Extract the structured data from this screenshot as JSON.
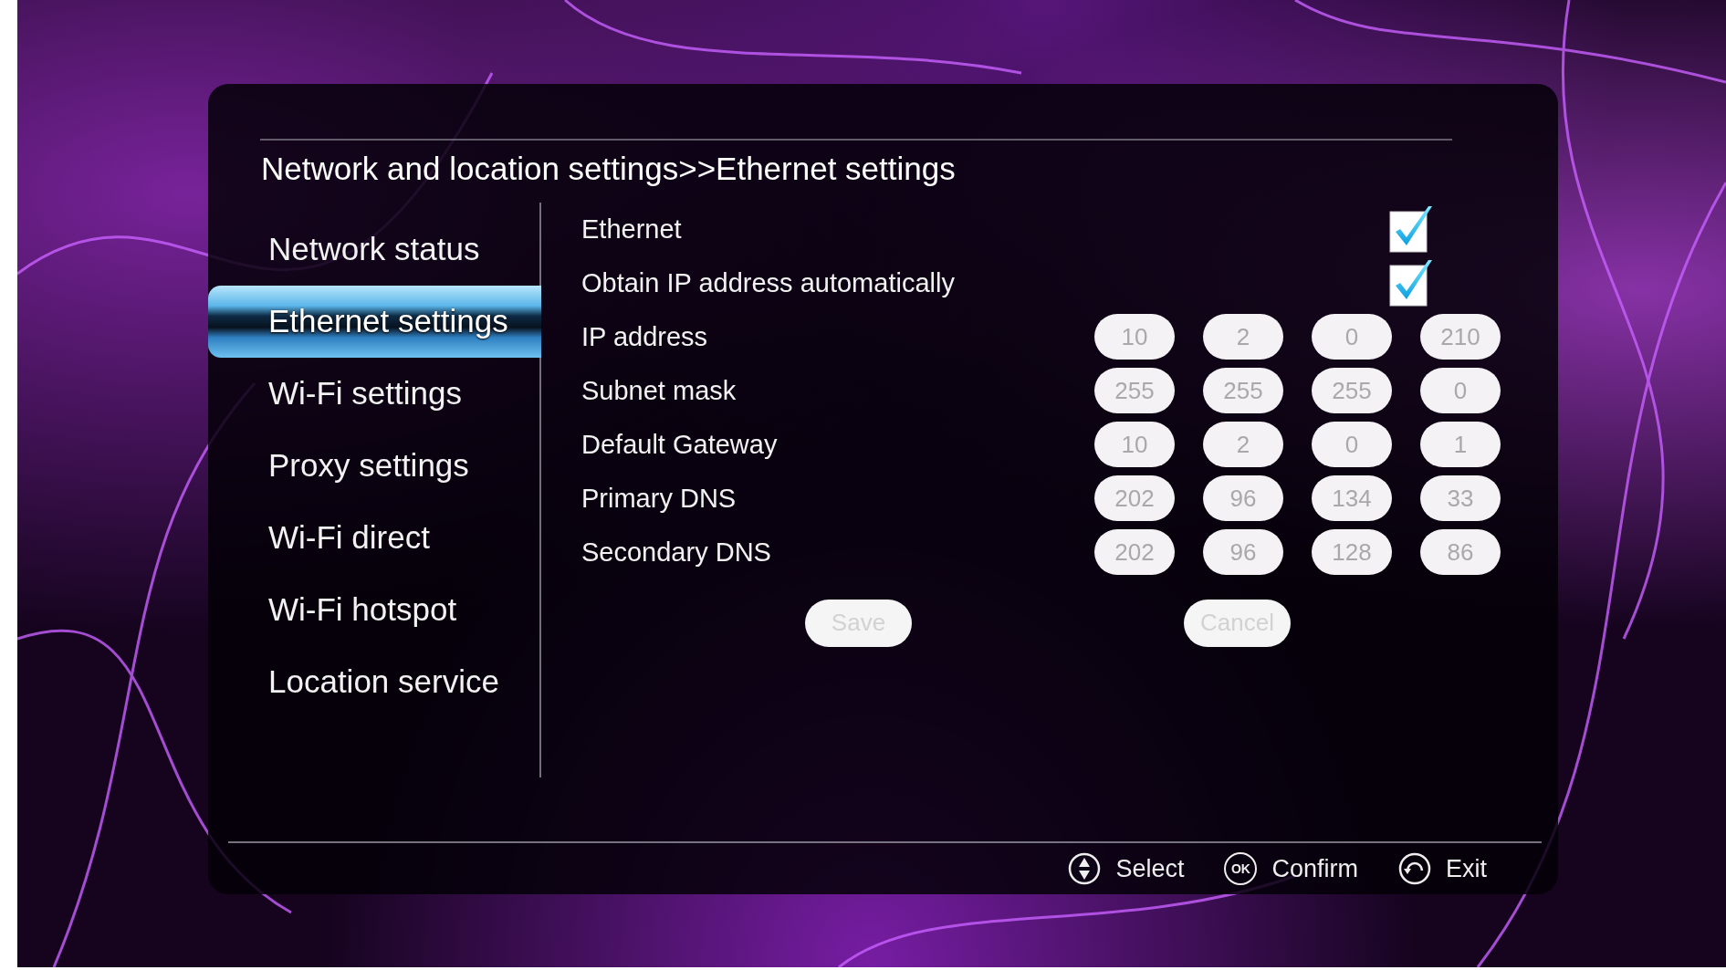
{
  "title": "Network and location settings>>Ethernet settings",
  "sidebar": {
    "items": [
      {
        "label": "Network status",
        "selected": false
      },
      {
        "label": "Ethernet settings",
        "selected": true
      },
      {
        "label": "Wi-Fi settings",
        "selected": false
      },
      {
        "label": "Proxy settings",
        "selected": false
      },
      {
        "label": "Wi-Fi direct",
        "selected": false
      },
      {
        "label": "Wi-Fi hotspot",
        "selected": false
      },
      {
        "label": "Location service",
        "selected": false
      }
    ]
  },
  "settings": {
    "rows": [
      {
        "kind": "checkbox",
        "label": "Ethernet",
        "checked": true
      },
      {
        "kind": "checkbox",
        "label": "Obtain IP address automatically",
        "checked": true
      },
      {
        "kind": "ip",
        "label": "IP address",
        "disabled": true,
        "octets": [
          "10",
          "2",
          "0",
          "210"
        ]
      },
      {
        "kind": "ip",
        "label": "Subnet mask",
        "disabled": true,
        "octets": [
          "255",
          "255",
          "255",
          "0"
        ]
      },
      {
        "kind": "ip",
        "label": "Default Gateway",
        "disabled": true,
        "octets": [
          "10",
          "2",
          "0",
          "1"
        ]
      },
      {
        "kind": "ip",
        "label": "Primary DNS",
        "disabled": true,
        "octets": [
          "202",
          "96",
          "134",
          "33"
        ]
      },
      {
        "kind": "ip",
        "label": "Secondary DNS",
        "disabled": true,
        "octets": [
          "202",
          "96",
          "128",
          "86"
        ]
      }
    ],
    "buttons": [
      {
        "label": "Save",
        "disabled": true
      },
      {
        "label": "Cancel",
        "disabled": true
      }
    ]
  },
  "footer": {
    "hints": [
      {
        "kind": "navigate",
        "label": "Select"
      },
      {
        "kind": "ok",
        "icon_text": "OK",
        "label": "Confirm"
      },
      {
        "kind": "back",
        "label": "Exit"
      }
    ]
  }
}
